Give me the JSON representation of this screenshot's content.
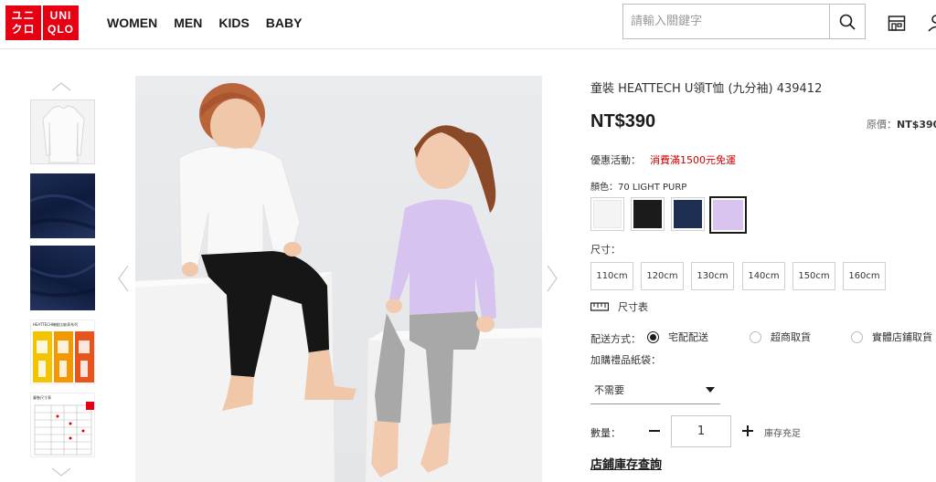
{
  "brand": {
    "logo_left_top": "ユニ",
    "logo_left_bottom": "クロ",
    "logo_right_top": "UNI",
    "logo_right_bottom": "QLO",
    "color": "#e60012"
  },
  "nav": {
    "items": [
      {
        "label": "WOMEN"
      },
      {
        "label": "MEN"
      },
      {
        "label": "KIDS"
      },
      {
        "label": "BABY"
      }
    ]
  },
  "search": {
    "placeholder": "請輸入關鍵字",
    "icon": "search-icon"
  },
  "header_icons": {
    "store": "store-icon",
    "account": "user-icon"
  },
  "product": {
    "title": "童裝 HEATTECH U領T恤 (九分袖) 439412",
    "price": "NT$390",
    "original_label": "原價：",
    "original_price": "NT$390",
    "promo_label": "優惠活動：",
    "promo_text": "消費滿1500元免運",
    "promo_color": "#cc0000",
    "color_label": "顏色：70 LIGHT PURP",
    "colors": [
      {
        "name": "white",
        "hex": "#f4f4f4"
      },
      {
        "name": "black",
        "hex": "#1b1b1b"
      },
      {
        "name": "navy",
        "hex": "#1f2f52"
      },
      {
        "name": "light-purple",
        "hex": "#d8c4ef",
        "selected": true
      }
    ],
    "size_label": "尺寸：",
    "sizes": [
      "110cm",
      "120cm",
      "130cm",
      "140cm",
      "150cm",
      "160cm"
    ],
    "size_chart_label": "尺寸表",
    "shipping_label": "配送方式：",
    "shipping_options": [
      {
        "label": "宅配配送",
        "selected": true
      },
      {
        "label": "超商取貨",
        "selected": false
      },
      {
        "label": "實體店鋪取貨",
        "selected": false
      }
    ],
    "bag_label": "加購禮品紙袋：",
    "bag_value": "不需要",
    "qty_label": "數量：",
    "qty_value": "1",
    "stock_text": "庫存充足",
    "store_link": "店鋪庫存查詢"
  },
  "thumbnails": [
    {
      "kind": "white-shirt"
    },
    {
      "kind": "navy-fabric"
    },
    {
      "kind": "navy-fabric"
    },
    {
      "kind": "infographic",
      "text": "HEATTECH機能比較表系列"
    },
    {
      "kind": "size-table",
      "text": "童裝尺寸表"
    }
  ]
}
